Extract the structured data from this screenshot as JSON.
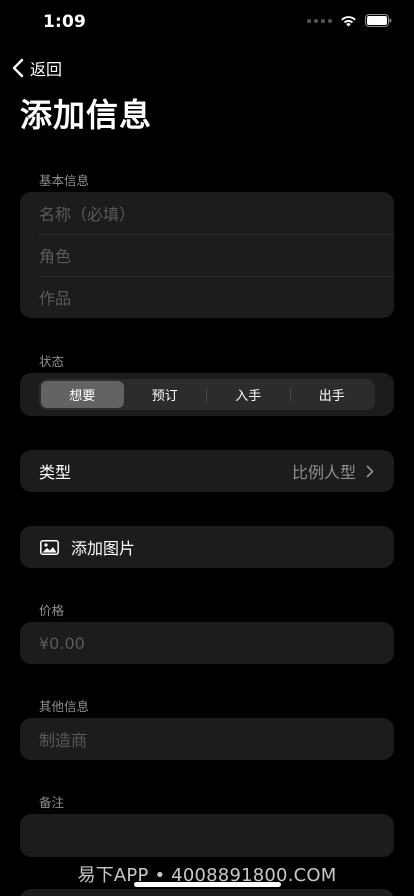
{
  "status_bar": {
    "time": "1:09"
  },
  "nav": {
    "back_label": "返回"
  },
  "page": {
    "title": "添加信息"
  },
  "basic_info": {
    "label": "基本信息",
    "fields": [
      {
        "placeholder": "名称（必填）",
        "value": ""
      },
      {
        "placeholder": "角色",
        "value": ""
      },
      {
        "placeholder": "作品",
        "value": ""
      }
    ]
  },
  "status": {
    "label": "状态",
    "options": [
      "想要",
      "预订",
      "入手",
      "出手"
    ],
    "selected": "想要"
  },
  "type": {
    "label": "类型",
    "value": "比例人型"
  },
  "photo": {
    "label": "添加图片"
  },
  "price": {
    "label": "价格",
    "placeholder": "¥0.00"
  },
  "other_info": {
    "label": "其他信息",
    "manufacturer_placeholder": "制造商"
  },
  "notes": {
    "label": "备注"
  },
  "watermark": {
    "text": "易下APP • 4008891800.COM"
  }
}
